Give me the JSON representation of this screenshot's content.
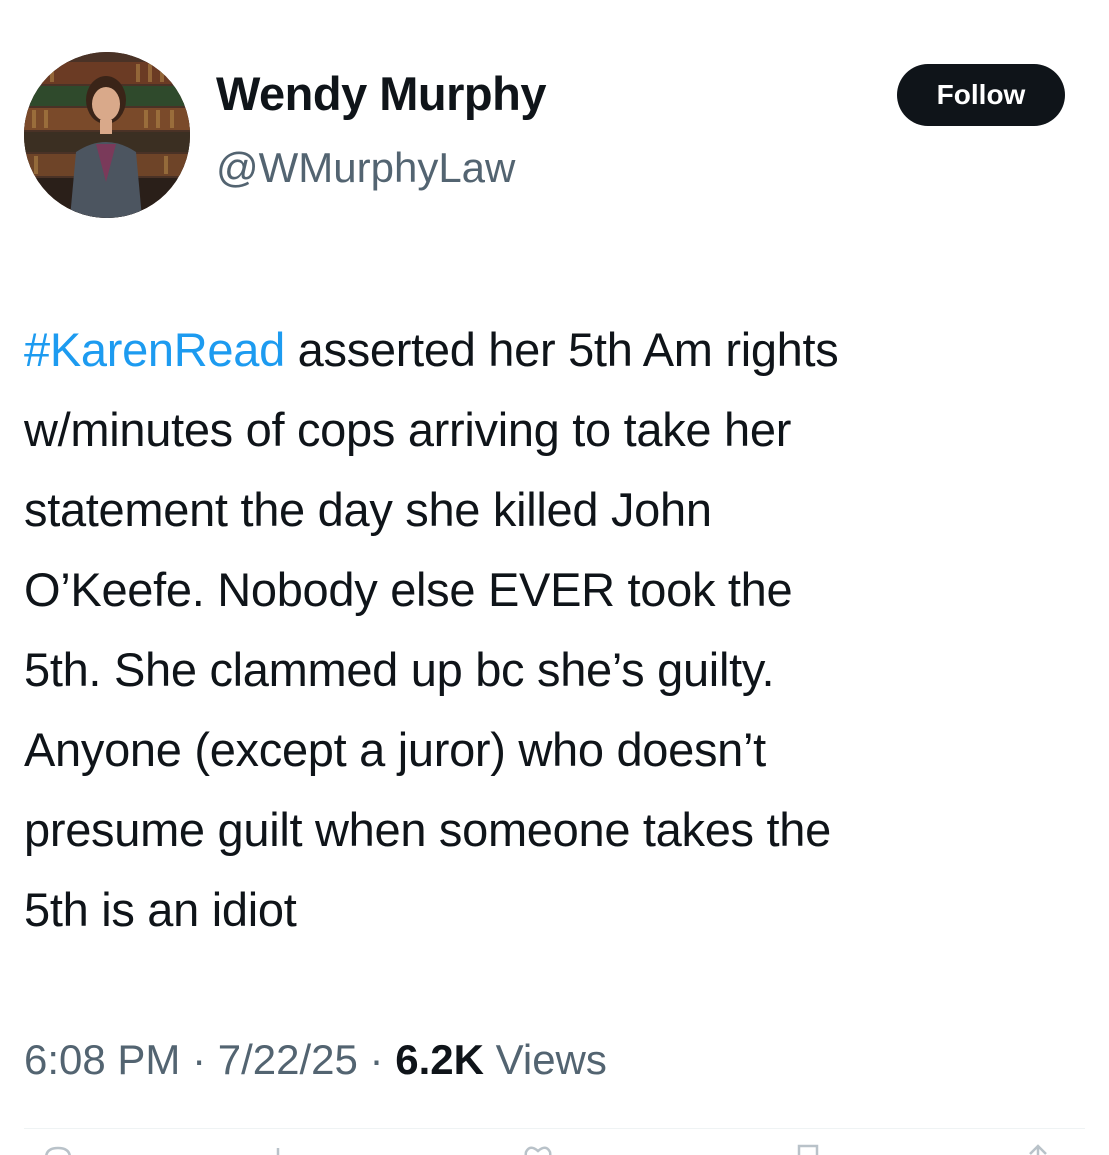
{
  "author": {
    "display_name": "Wendy Murphy",
    "handle": "@WMurphyLaw",
    "avatar_icon": "profile-photo"
  },
  "follow_button": {
    "label": "Follow"
  },
  "tweet": {
    "hashtag": "#KarenRead",
    "lines": [
      " asserted her 5th Am rights",
      "w/minutes of cops arriving to take her",
      "statement the day she killed John",
      "O’Keefe. Nobody else EVER took the",
      "5th. She clammed up bc she’s guilty.",
      "Anyone (except a juror) who doesn’t",
      "presume guilt when someone takes the",
      "5th is an idiot"
    ]
  },
  "meta": {
    "time": "6:08 PM",
    "separator": " · ",
    "date": "7/22/25",
    "views_count": "6.2K",
    "views_label": " Views"
  },
  "actions": [
    {
      "icon": "reply-icon"
    },
    {
      "icon": "retweet-icon"
    },
    {
      "icon": "like-icon"
    },
    {
      "icon": "bookmark-icon"
    },
    {
      "icon": "share-icon"
    }
  ],
  "colors": {
    "text": "#0f1419",
    "secondary": "#536471",
    "link": "#1d9bf0",
    "button_bg": "#0f1419",
    "button_text": "#ffffff"
  }
}
